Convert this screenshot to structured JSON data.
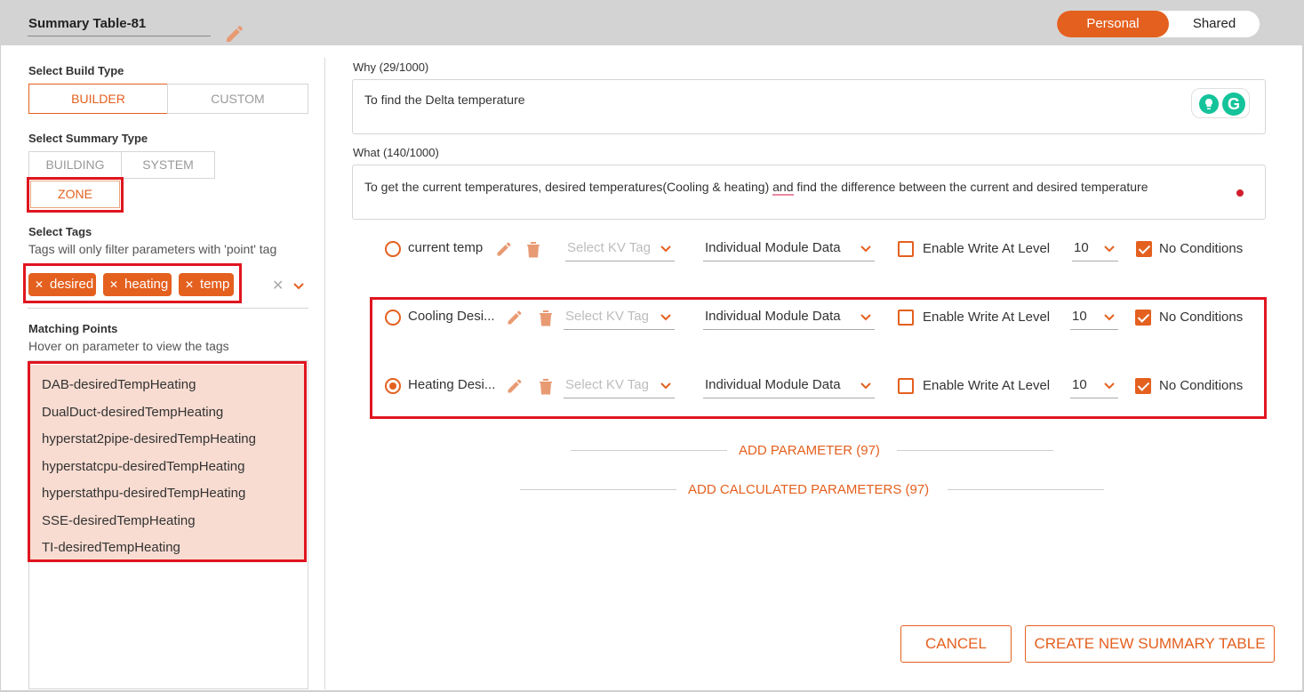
{
  "header": {
    "title": "Summary Table-81",
    "toggle": {
      "personal_label": "Personal",
      "shared_label": "Shared",
      "active": "Personal"
    }
  },
  "sidebar": {
    "build_type": {
      "label": "Select Build Type",
      "options": [
        "BUILDER",
        "CUSTOM"
      ],
      "selected": "BUILDER"
    },
    "summary_type": {
      "label": "Select Summary Type",
      "options": [
        "BUILDING",
        "SYSTEM",
        "ZONE"
      ],
      "selected": "ZONE"
    },
    "tags": {
      "label": "Select Tags",
      "hint": "Tags will only filter parameters with 'point' tag",
      "selected": [
        "desired",
        "heating",
        "temp"
      ],
      "clear_icon": "close-icon",
      "dropdown_icon": "chevron-down-icon"
    },
    "matching_points": {
      "label": "Matching Points",
      "hint": "Hover on parameter to view the tags",
      "items": [
        "DAB-desiredTempHeating",
        "DualDuct-desiredTempHeating",
        "hyperstat2pipe-desiredTempHeating",
        "hyperstatcpu-desiredTempHeating",
        "hyperstathpu-desiredTempHeating",
        "SSE-desiredTempHeating",
        "TI-desiredTempHeating"
      ]
    }
  },
  "main": {
    "why": {
      "label": "Why (29/1000)",
      "value": "To find the Delta temperature"
    },
    "what": {
      "label": "What (140/1000)",
      "value_before": "To get the current temperatures, desired temperatures(Cooling & heating) ",
      "value_underlined": "and",
      "value_after": " find the difference between the current and desired temperature"
    },
    "parameters": [
      {
        "name": "current temp",
        "kv_tag_placeholder": "Select KV Tag",
        "module": "Individual Module Data",
        "enable_write_label": "Enable Write At Level",
        "enable_write": false,
        "level": "10",
        "no_conditions_label": "No Conditions",
        "no_conditions": true,
        "selected": false
      },
      {
        "name": "Cooling Desi...",
        "kv_tag_placeholder": "Select KV Tag",
        "module": "Individual Module Data",
        "enable_write_label": "Enable Write At Level",
        "enable_write": false,
        "level": "10",
        "no_conditions_label": "No Conditions",
        "no_conditions": true,
        "selected": false
      },
      {
        "name": "Heating Desi...",
        "kv_tag_placeholder": "Select KV Tag",
        "module": "Individual Module Data",
        "enable_write_label": "Enable Write At Level",
        "enable_write": false,
        "level": "10",
        "no_conditions_label": "No Conditions",
        "no_conditions": true,
        "selected": true
      }
    ],
    "add_parameter_label": "ADD PARAMETER (97)",
    "add_calculated_label": "ADD CALCULATED PARAMETERS (97)",
    "cancel_label": "CANCEL",
    "create_label": "CREATE NEW SUMMARY TABLE"
  },
  "colors": {
    "accent": "#e4601f",
    "highlight_box": "#e0151f",
    "points_bg": "#f8dcd1",
    "header_bg": "#d3d3d3"
  }
}
